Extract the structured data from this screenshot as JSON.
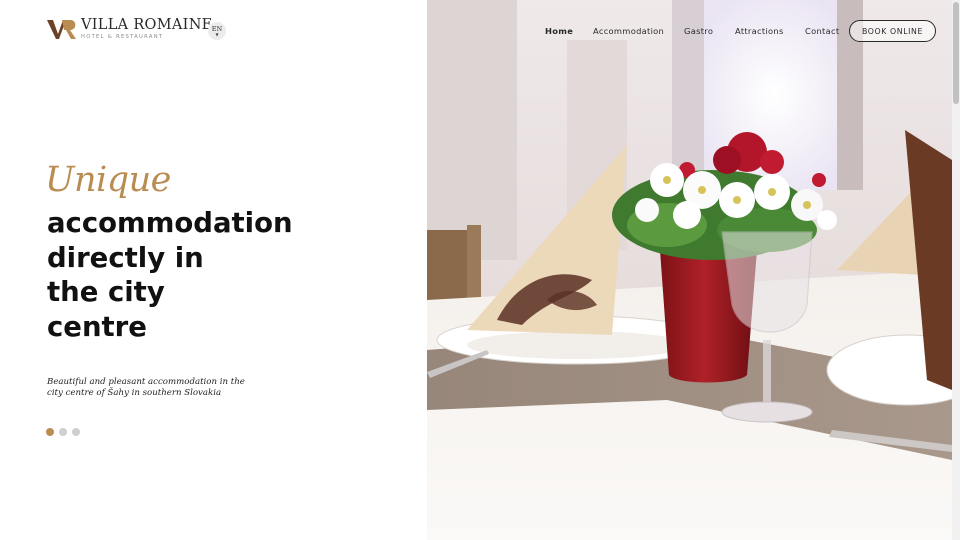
{
  "brand": {
    "name": "VILLA ROMAINE",
    "subtitle": "HOTEL & RESTAURANT",
    "colors": {
      "accent": "#b98c52",
      "mark_dark": "#6b4226",
      "text": "#111111"
    }
  },
  "language": {
    "current": "EN"
  },
  "nav": {
    "items": [
      {
        "label": "Home",
        "active": true
      },
      {
        "label": "Accommodation",
        "active": false
      },
      {
        "label": "Gastro",
        "active": false
      },
      {
        "label": "Attractions",
        "active": false
      },
      {
        "label": "Contact",
        "active": false
      }
    ],
    "cta": "BOOK ONLINE"
  },
  "hero": {
    "script_word": "Unique",
    "title_lines": [
      "accommodation",
      "directly in",
      "the city",
      "centre"
    ],
    "description_lines": [
      "Beautiful and pleasant accommodation in the",
      "city centre of Šahy in southern Slovakia"
    ],
    "slides": {
      "count": 3,
      "active_index": 0
    }
  },
  "photo": {
    "subject": "restaurant table setting with red flower vase, folded napkins and wine glass"
  }
}
